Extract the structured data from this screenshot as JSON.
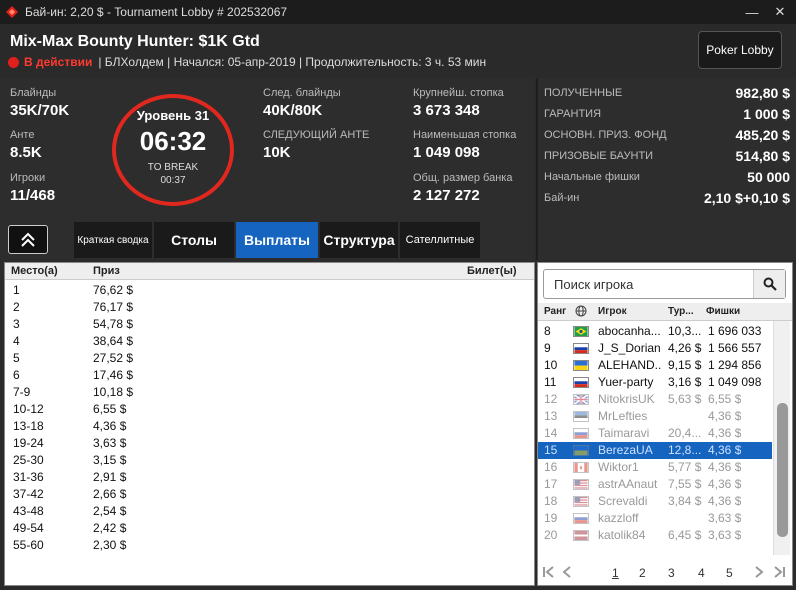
{
  "window": {
    "title": "Бай-ин: 2,20 $ - Tournament Lobby # 202532067"
  },
  "header": {
    "tournament_name": "Mix-Max Bounty Hunter: $1K Gtd",
    "status": "В действии",
    "game": "| БЛХолдем",
    "started": "| Началcя: 05-апр-2019",
    "duration": "| Продолжительность: 3 ч. 53 мин",
    "poker_lobby": "Poker Lobby"
  },
  "stats": {
    "blinds_label": "Блайнды",
    "blinds": "35K/70K",
    "ante_label": "Анте",
    "ante": "8.5K",
    "players_label": "Игроки",
    "players": "11/468",
    "next_blinds_label": "След. блайнды",
    "next_blinds": "40K/80K",
    "next_ante_label": "СЛЕДУЮЩИЙ АНТЕ",
    "next_ante": "10K",
    "largest_stack_label": "Крупнейш. стопка",
    "largest_stack": "3 673 348",
    "smallest_stack_label": "Наименьшая стопка",
    "smallest_stack": "1 049 098",
    "total_pot_label": "Общ. размер банка",
    "total_pot": "2 127 272"
  },
  "level": {
    "label": "Уровень 31",
    "timer": "06:32",
    "to_break_label": "TO BREAK",
    "to_break": "00:37"
  },
  "prizes": [
    {
      "label": "ПОЛУЧЕННЫЕ",
      "value": "982,80 $"
    },
    {
      "label": "ГАРАНТИЯ",
      "value": "1 000 $"
    },
    {
      "label": "ОСНОВН. ПРИЗ. ФОНД",
      "value": "485,20 $"
    },
    {
      "label": "ПРИЗОВЫЕ БАУНТИ",
      "value": "514,80 $"
    },
    {
      "label": "Начальные фишки",
      "value": "50 000"
    },
    {
      "label": "Бай-ин",
      "value": "2,10 $+0,10 $"
    }
  ],
  "tabs": [
    {
      "label": "Краткая сводка",
      "active": false
    },
    {
      "label": "Столы",
      "active": false
    },
    {
      "label": "Выплаты",
      "active": true
    },
    {
      "label": "Структура",
      "active": false
    },
    {
      "label": "Сателлитные",
      "active": false
    }
  ],
  "payouts": {
    "columns": [
      "Место(а)",
      "Приз",
      "Билет(ы)"
    ],
    "rows": [
      [
        "1",
        "76,62 $"
      ],
      [
        "2",
        "76,17 $"
      ],
      [
        "3",
        "54,78 $"
      ],
      [
        "4",
        "38,64 $"
      ],
      [
        "5",
        "27,52 $"
      ],
      [
        "6",
        "17,46 $"
      ],
      [
        "7-9",
        "10,18 $"
      ],
      [
        "10-12",
        "6,55 $"
      ],
      [
        "13-18",
        "4,36 $"
      ],
      [
        "19-24",
        "3,63 $"
      ],
      [
        "25-30",
        "3,15 $"
      ],
      [
        "31-36",
        "2,91 $"
      ],
      [
        "37-42",
        "2,66 $"
      ],
      [
        "43-48",
        "2,54 $"
      ],
      [
        "49-54",
        "2,42 $"
      ],
      [
        "55-60",
        "2,30 $"
      ]
    ]
  },
  "players_panel": {
    "search_placeholder": "Поиск игрока",
    "columns": [
      "Ранг",
      "Игрок",
      "Тур...",
      "Фишки"
    ],
    "rows": [
      {
        "rank": "8",
        "flag": "brazil",
        "name": "abocanha...",
        "tour": "10,3...",
        "chips": "1 696 033",
        "state": "active"
      },
      {
        "rank": "9",
        "flag": "russia",
        "name": "J_S_Dorian",
        "tour": "4,26 $",
        "chips": "1 566 557",
        "state": "active"
      },
      {
        "rank": "10",
        "flag": "ukraine",
        "name": "ALEHAND...",
        "tour": "9,15 $",
        "chips": "1 294 856",
        "state": "active"
      },
      {
        "rank": "11",
        "flag": "russia",
        "name": "Yuer-party",
        "tour": "3,16 $",
        "chips": "1 049 098",
        "state": "active"
      },
      {
        "rank": "12",
        "flag": "uk",
        "name": "NitokrisUK",
        "tour": "5,63 $",
        "chips": "6,55 $",
        "state": "out"
      },
      {
        "rank": "13",
        "flag": "estonia",
        "name": "MrLefties",
        "tour": "",
        "chips": "4,36 $",
        "state": "out"
      },
      {
        "rank": "14",
        "flag": "russia",
        "name": "Taimaravi",
        "tour": "20,4...",
        "chips": "4,36 $",
        "state": "out"
      },
      {
        "rank": "15",
        "flag": "ukraine",
        "name": "BerezaUA",
        "tour": "12,8...",
        "chips": "4,36 $",
        "state": "selected"
      },
      {
        "rank": "16",
        "flag": "canada",
        "name": "Wiktor1",
        "tour": "5,77 $",
        "chips": "4,36 $",
        "state": "out"
      },
      {
        "rank": "17",
        "flag": "usa",
        "name": "astrAAnaut",
        "tour": "7,55 $",
        "chips": "4,36 $",
        "state": "out"
      },
      {
        "rank": "18",
        "flag": "usa",
        "name": "Screvaldi",
        "tour": "3,84 $",
        "chips": "4,36 $",
        "state": "out"
      },
      {
        "rank": "19",
        "flag": "russia",
        "name": "kazzloff",
        "tour": "",
        "chips": "3,63 $",
        "state": "out"
      },
      {
        "rank": "20",
        "flag": "latvia",
        "name": "katolik84",
        "tour": "6,45 $",
        "chips": "3,63 $",
        "state": "out"
      }
    ],
    "pages": [
      "1",
      "2",
      "3",
      "4",
      "5"
    ],
    "current_page": "1"
  },
  "colors": {
    "accent": "#1565c0",
    "status_red": "#e0201c",
    "timer_ring": "#e0281e"
  }
}
